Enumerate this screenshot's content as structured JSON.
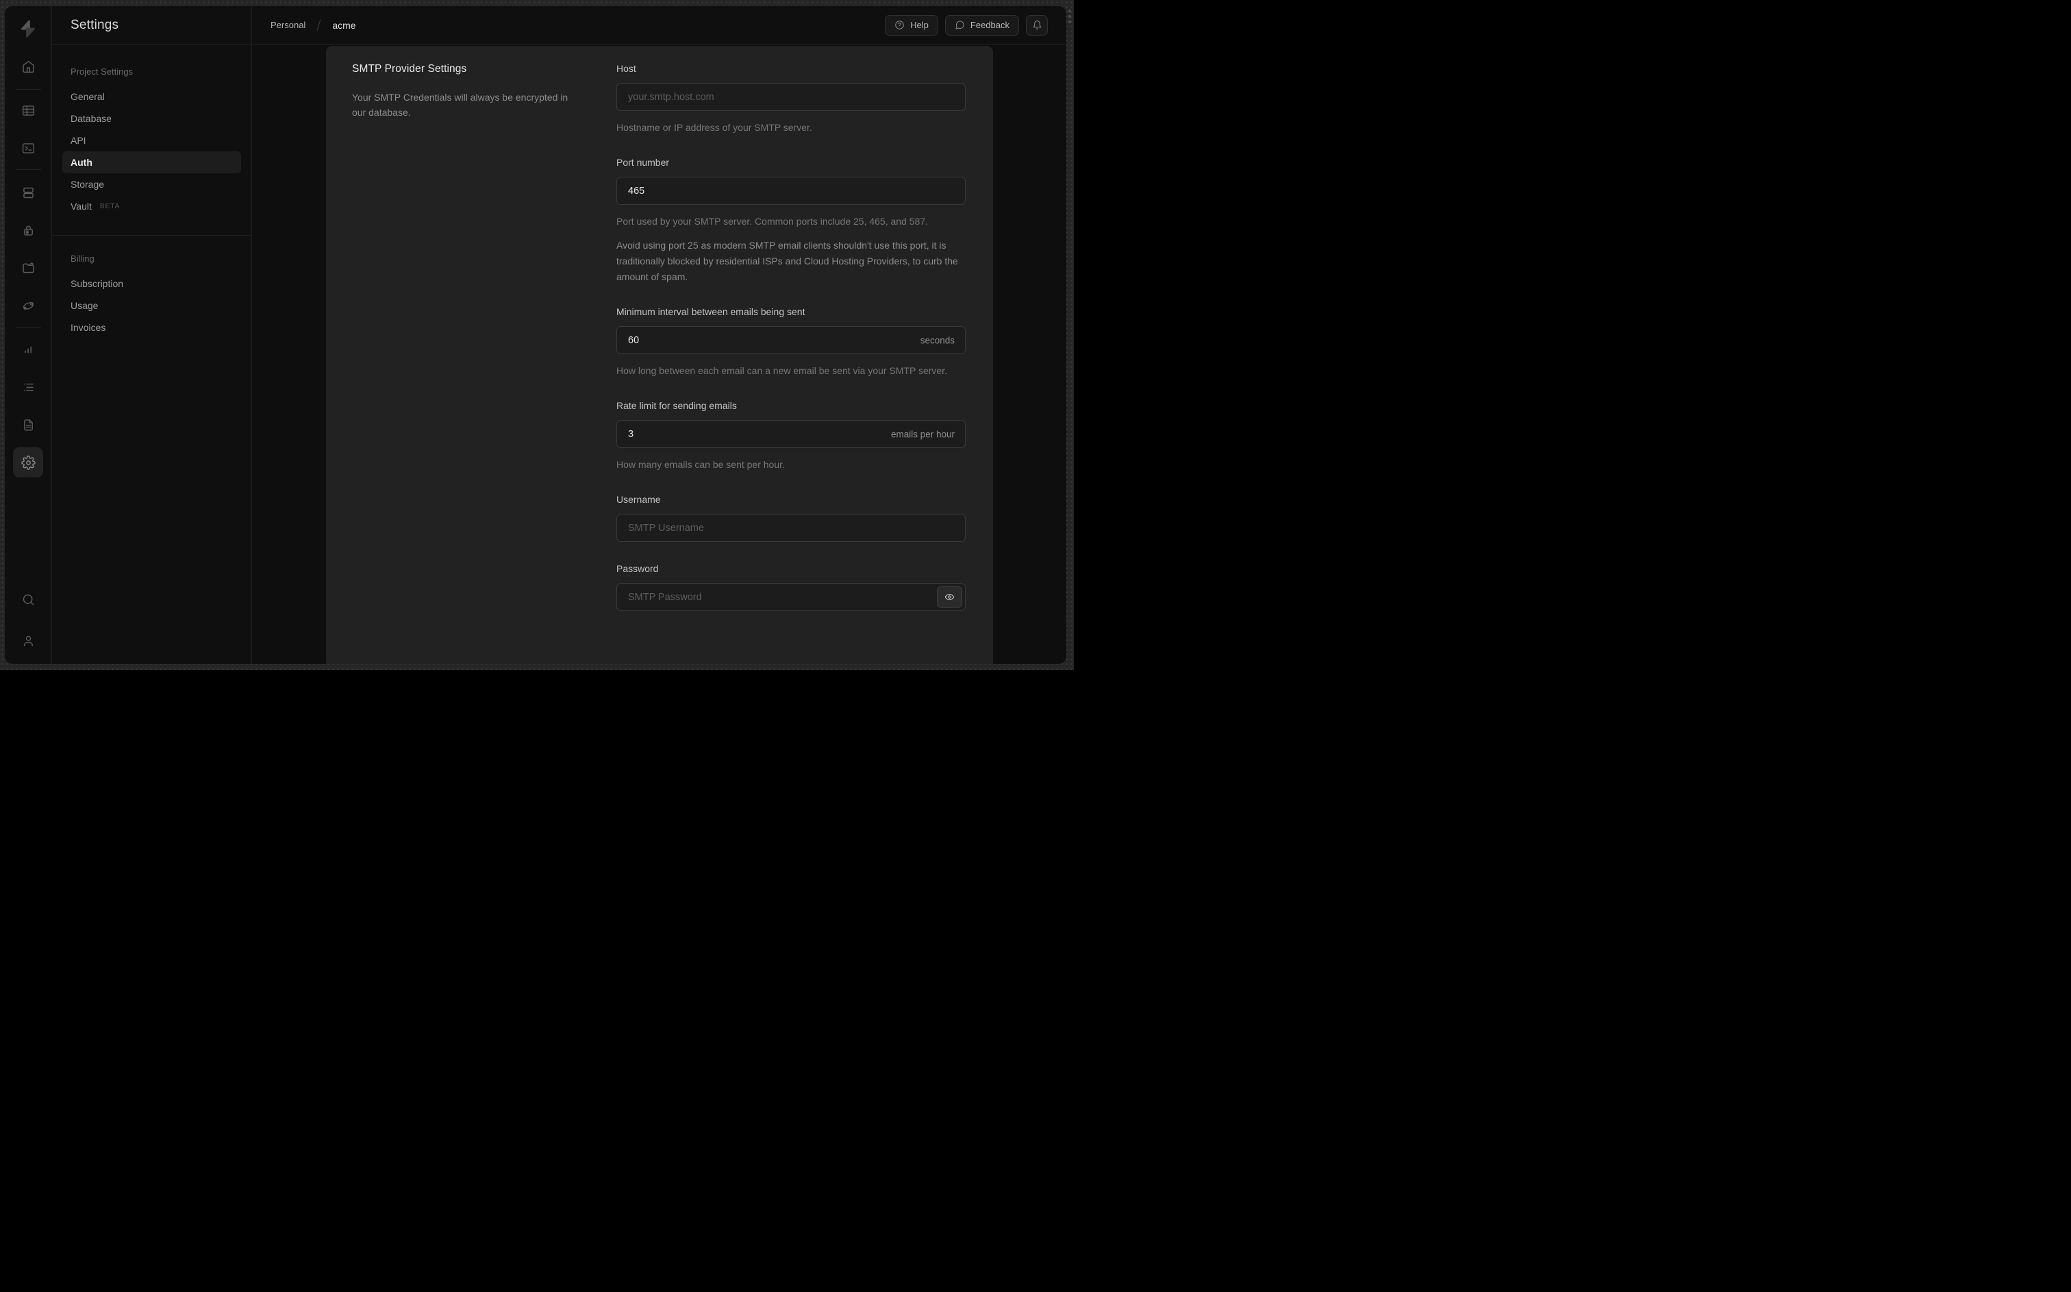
{
  "colors": {
    "frame_bg": "#262626",
    "window_bg": "#0f0f0f",
    "card_bg": "#222222",
    "input_bg": "#1c1c1c",
    "input_border": "#3a3a3a",
    "text_bright": "#ececec"
  },
  "rail": {
    "icons": [
      "supabase-logo",
      "home",
      "table-editor",
      "sql-editor",
      "database",
      "authentication",
      "storage",
      "edge-functions",
      "reports",
      "logs",
      "docs",
      "project-settings",
      "search",
      "user"
    ]
  },
  "settings_nav": {
    "title": "Settings",
    "sections": [
      {
        "heading": "Project Settings",
        "items": [
          {
            "label": "General"
          },
          {
            "label": "Database"
          },
          {
            "label": "API"
          },
          {
            "label": "Auth",
            "active": true
          },
          {
            "label": "Storage"
          },
          {
            "label": "Vault",
            "badge": "BETA"
          }
        ]
      },
      {
        "heading": "Billing",
        "items": [
          {
            "label": "Subscription"
          },
          {
            "label": "Usage"
          },
          {
            "label": "Invoices"
          }
        ]
      }
    ]
  },
  "topbar": {
    "breadcrumb": {
      "org": "Personal",
      "project": "acme"
    },
    "help_label": "Help",
    "feedback_label": "Feedback",
    "icons": [
      "help-circle-icon",
      "chat-bubble-icon",
      "bell-icon"
    ]
  },
  "content": {
    "section_title": "SMTP Provider Settings",
    "section_description": "Your SMTP Credentials will always be encrypted in our database.",
    "fields": {
      "host": {
        "label": "Host",
        "placeholder": "your.smtp.host.com",
        "helper": "Hostname or IP address of your SMTP server."
      },
      "port": {
        "label": "Port number",
        "value": "465",
        "helper": "Port used by your SMTP server. Common ports include 25, 465, and 587.",
        "note": "Avoid using port 25 as modern SMTP email clients shouldn't use this port, it is traditionally blocked by residential ISPs and Cloud Hosting Providers, to curb the amount of spam."
      },
      "interval": {
        "label": "Minimum interval between emails being sent",
        "value": "60",
        "unit": "seconds",
        "helper": "How long between each email can a new email be sent via your SMTP server."
      },
      "rate_limit": {
        "label": "Rate limit for sending emails",
        "value": "3",
        "unit": "emails per hour",
        "helper": "How many emails can be sent per hour."
      },
      "username": {
        "label": "Username",
        "placeholder": "SMTP Username"
      },
      "password": {
        "label": "Password",
        "placeholder": "SMTP Password"
      }
    }
  }
}
